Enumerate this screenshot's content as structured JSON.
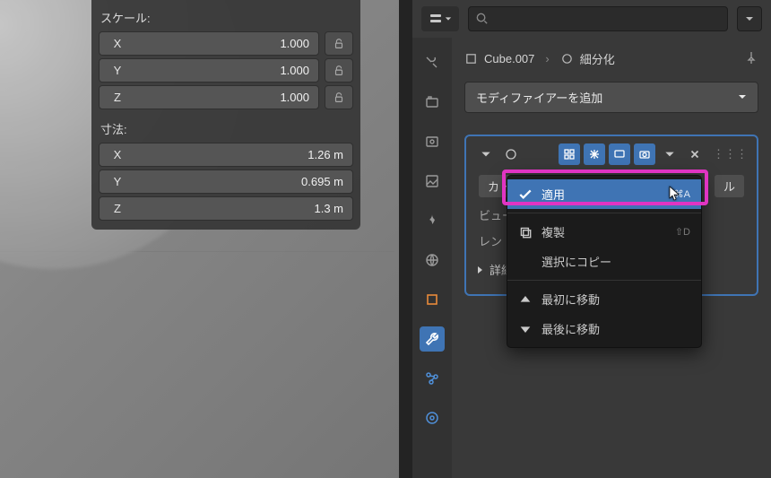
{
  "transform": {
    "scale_label": "スケール:",
    "scale": {
      "x": "X",
      "x_val": "1.000",
      "y": "Y",
      "y_val": "1.000",
      "z": "Z",
      "z_val": "1.000"
    },
    "dim_label": "寸法:",
    "dim": {
      "x": "X",
      "x_val": "1.26 m",
      "y": "Y",
      "y_val": "0.695 m",
      "z": "Z",
      "z_val": "1.3 m"
    }
  },
  "header": {
    "search_placeholder": ""
  },
  "breadcrumb": {
    "object": "Cube.007",
    "modifier": "細分化"
  },
  "add_modifier": "モディファイアーを追加",
  "mod_body": {
    "row1_left": "カト",
    "row1_right": "ル",
    "row2_left": "ビュー",
    "row3_left": "レン",
    "detail": "詳細設定"
  },
  "menu": {
    "apply": "適用",
    "apply_sc": "⌘A",
    "duplicate": "複製",
    "duplicate_sc": "⇧D",
    "copy": "選択にコピー",
    "move_first": "最初に移動",
    "move_last": "最後に移動"
  }
}
